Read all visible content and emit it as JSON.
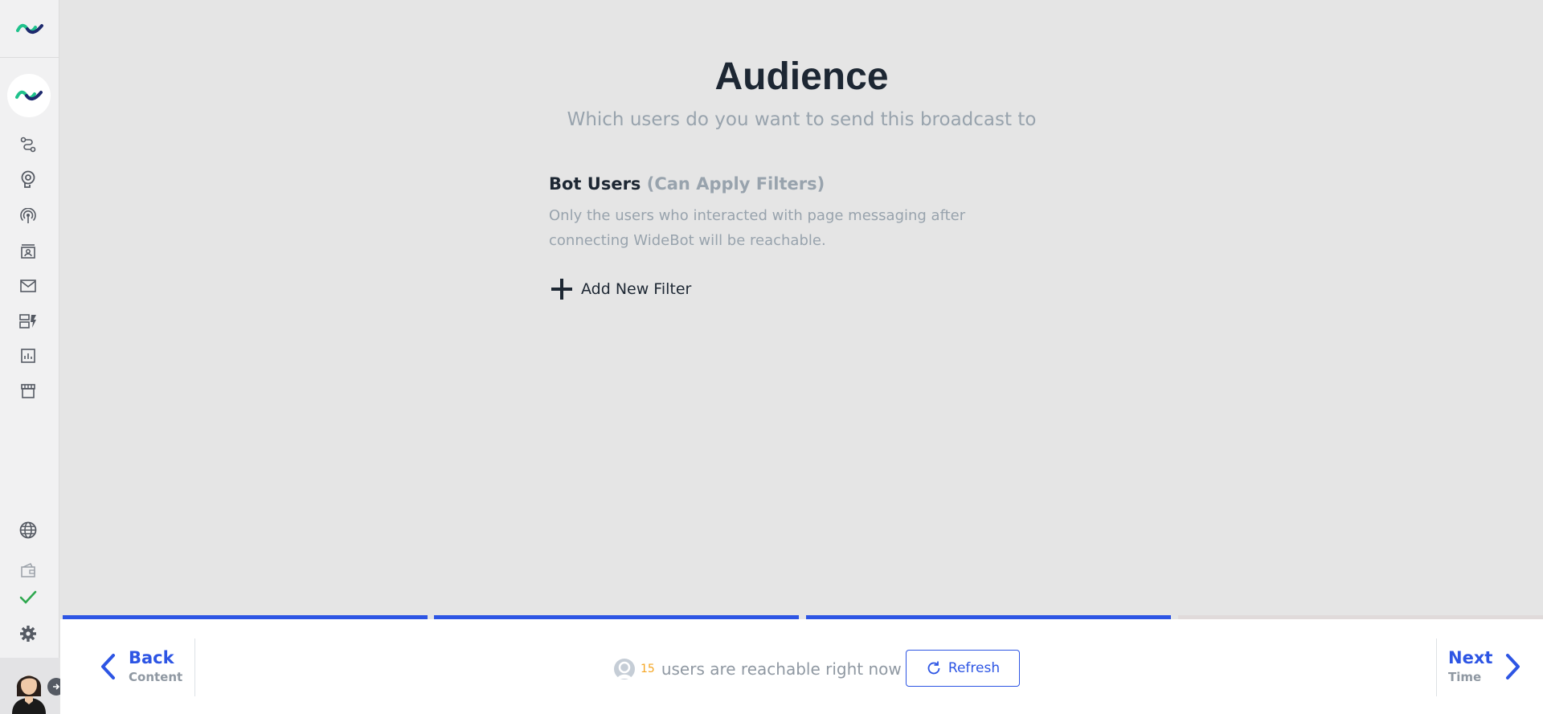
{
  "page": {
    "title": "Audience",
    "subtitle": "Which users do you want to send this broadcast to"
  },
  "section": {
    "title": "Bot Users",
    "hint": "(Can Apply Filters)",
    "description": "Only the users who interacted with page messaging after connecting WideBot will be reachable."
  },
  "add_filter": {
    "label": "Add New Filter"
  },
  "sidebar": {
    "items": [
      "flows-icon",
      "ai-brain-icon",
      "broadcast-icon",
      "users-icon",
      "inbox-icon",
      "templates-icon",
      "analytics-icon",
      "store-icon"
    ],
    "bottom_items": [
      "globe-icon",
      "wallet-icon",
      "check-icon",
      "gear-icon"
    ]
  },
  "progress": {
    "steps_completed": 3,
    "steps_total": 4,
    "active_color": "#2d55e4",
    "inactive_color": "#e0dada"
  },
  "footer": {
    "back_label": "Back",
    "back_sub": "Content",
    "next_label": "Next",
    "next_sub": "Time",
    "reach_count": "15",
    "reach_text": "users are reachable right now",
    "refresh_label": "Refresh"
  },
  "colors": {
    "accent": "#2d55e4",
    "brand_green": "#1fc28c",
    "brand_navy": "#1e2a6e",
    "count_orange": "#f5a623"
  }
}
